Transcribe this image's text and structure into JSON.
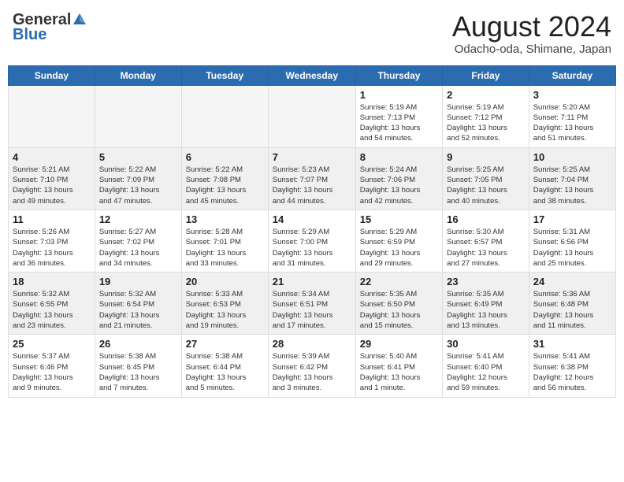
{
  "header": {
    "logo_general": "General",
    "logo_blue": "Blue",
    "title": "August 2024",
    "subtitle": "Odacho-oda, Shimane, Japan"
  },
  "columns": [
    "Sunday",
    "Monday",
    "Tuesday",
    "Wednesday",
    "Thursday",
    "Friday",
    "Saturday"
  ],
  "weeks": [
    [
      {
        "day": "",
        "info": ""
      },
      {
        "day": "",
        "info": ""
      },
      {
        "day": "",
        "info": ""
      },
      {
        "day": "",
        "info": ""
      },
      {
        "day": "1",
        "info": "Sunrise: 5:19 AM\nSunset: 7:13 PM\nDaylight: 13 hours\nand 54 minutes."
      },
      {
        "day": "2",
        "info": "Sunrise: 5:19 AM\nSunset: 7:12 PM\nDaylight: 13 hours\nand 52 minutes."
      },
      {
        "day": "3",
        "info": "Sunrise: 5:20 AM\nSunset: 7:11 PM\nDaylight: 13 hours\nand 51 minutes."
      }
    ],
    [
      {
        "day": "4",
        "info": "Sunrise: 5:21 AM\nSunset: 7:10 PM\nDaylight: 13 hours\nand 49 minutes."
      },
      {
        "day": "5",
        "info": "Sunrise: 5:22 AM\nSunset: 7:09 PM\nDaylight: 13 hours\nand 47 minutes."
      },
      {
        "day": "6",
        "info": "Sunrise: 5:22 AM\nSunset: 7:08 PM\nDaylight: 13 hours\nand 45 minutes."
      },
      {
        "day": "7",
        "info": "Sunrise: 5:23 AM\nSunset: 7:07 PM\nDaylight: 13 hours\nand 44 minutes."
      },
      {
        "day": "8",
        "info": "Sunrise: 5:24 AM\nSunset: 7:06 PM\nDaylight: 13 hours\nand 42 minutes."
      },
      {
        "day": "9",
        "info": "Sunrise: 5:25 AM\nSunset: 7:05 PM\nDaylight: 13 hours\nand 40 minutes."
      },
      {
        "day": "10",
        "info": "Sunrise: 5:25 AM\nSunset: 7:04 PM\nDaylight: 13 hours\nand 38 minutes."
      }
    ],
    [
      {
        "day": "11",
        "info": "Sunrise: 5:26 AM\nSunset: 7:03 PM\nDaylight: 13 hours\nand 36 minutes."
      },
      {
        "day": "12",
        "info": "Sunrise: 5:27 AM\nSunset: 7:02 PM\nDaylight: 13 hours\nand 34 minutes."
      },
      {
        "day": "13",
        "info": "Sunrise: 5:28 AM\nSunset: 7:01 PM\nDaylight: 13 hours\nand 33 minutes."
      },
      {
        "day": "14",
        "info": "Sunrise: 5:29 AM\nSunset: 7:00 PM\nDaylight: 13 hours\nand 31 minutes."
      },
      {
        "day": "15",
        "info": "Sunrise: 5:29 AM\nSunset: 6:59 PM\nDaylight: 13 hours\nand 29 minutes."
      },
      {
        "day": "16",
        "info": "Sunrise: 5:30 AM\nSunset: 6:57 PM\nDaylight: 13 hours\nand 27 minutes."
      },
      {
        "day": "17",
        "info": "Sunrise: 5:31 AM\nSunset: 6:56 PM\nDaylight: 13 hours\nand 25 minutes."
      }
    ],
    [
      {
        "day": "18",
        "info": "Sunrise: 5:32 AM\nSunset: 6:55 PM\nDaylight: 13 hours\nand 23 minutes."
      },
      {
        "day": "19",
        "info": "Sunrise: 5:32 AM\nSunset: 6:54 PM\nDaylight: 13 hours\nand 21 minutes."
      },
      {
        "day": "20",
        "info": "Sunrise: 5:33 AM\nSunset: 6:53 PM\nDaylight: 13 hours\nand 19 minutes."
      },
      {
        "day": "21",
        "info": "Sunrise: 5:34 AM\nSunset: 6:51 PM\nDaylight: 13 hours\nand 17 minutes."
      },
      {
        "day": "22",
        "info": "Sunrise: 5:35 AM\nSunset: 6:50 PM\nDaylight: 13 hours\nand 15 minutes."
      },
      {
        "day": "23",
        "info": "Sunrise: 5:35 AM\nSunset: 6:49 PM\nDaylight: 13 hours\nand 13 minutes."
      },
      {
        "day": "24",
        "info": "Sunrise: 5:36 AM\nSunset: 6:48 PM\nDaylight: 13 hours\nand 11 minutes."
      }
    ],
    [
      {
        "day": "25",
        "info": "Sunrise: 5:37 AM\nSunset: 6:46 PM\nDaylight: 13 hours\nand 9 minutes."
      },
      {
        "day": "26",
        "info": "Sunrise: 5:38 AM\nSunset: 6:45 PM\nDaylight: 13 hours\nand 7 minutes."
      },
      {
        "day": "27",
        "info": "Sunrise: 5:38 AM\nSunset: 6:44 PM\nDaylight: 13 hours\nand 5 minutes."
      },
      {
        "day": "28",
        "info": "Sunrise: 5:39 AM\nSunset: 6:42 PM\nDaylight: 13 hours\nand 3 minutes."
      },
      {
        "day": "29",
        "info": "Sunrise: 5:40 AM\nSunset: 6:41 PM\nDaylight: 13 hours\nand 1 minute."
      },
      {
        "day": "30",
        "info": "Sunrise: 5:41 AM\nSunset: 6:40 PM\nDaylight: 12 hours\nand 59 minutes."
      },
      {
        "day": "31",
        "info": "Sunrise: 5:41 AM\nSunset: 6:38 PM\nDaylight: 12 hours\nand 56 minutes."
      }
    ]
  ]
}
